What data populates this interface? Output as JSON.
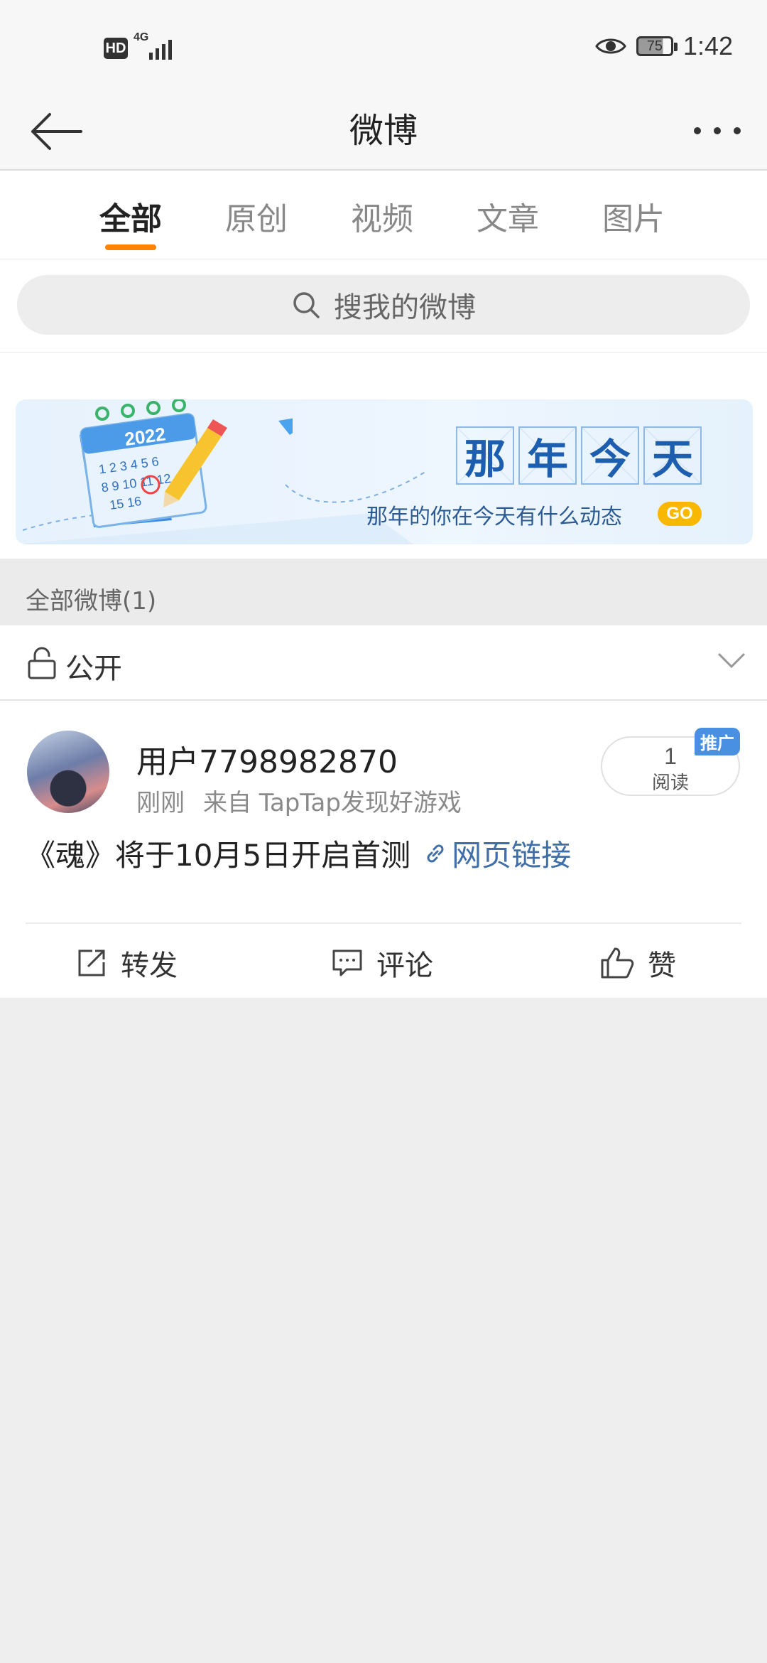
{
  "status_bar": {
    "hd": "HD",
    "network": "4G",
    "battery": "75",
    "time": "1:42"
  },
  "header": {
    "title": "微博"
  },
  "tabs": [
    {
      "label": "全部",
      "active": true
    },
    {
      "label": "原创",
      "active": false
    },
    {
      "label": "视频",
      "active": false
    },
    {
      "label": "文章",
      "active": false
    },
    {
      "label": "图片",
      "active": false
    }
  ],
  "search": {
    "placeholder": "搜我的微博"
  },
  "banner": {
    "calendar_year": "2022",
    "title_chars": [
      "那",
      "年",
      "今",
      "天"
    ],
    "subtitle": "那年的你在今天有什么动态",
    "go_label": "GO"
  },
  "section": {
    "header": "全部微博(1)",
    "visibility": "公开"
  },
  "post": {
    "username": "用户7798982870",
    "time": "刚刚",
    "source": "来自 TapTap发现好游戏",
    "read_count": "1",
    "read_label": "阅读",
    "promo_badge": "推广",
    "text": "《魂》将于10月5日开启首测",
    "link_label": "网页链接"
  },
  "actions": {
    "repost": "转发",
    "comment": "评论",
    "like": "赞"
  },
  "colors": {
    "accent": "#ff8200",
    "link": "#3f6ea8",
    "badge": "#4a90e2"
  }
}
